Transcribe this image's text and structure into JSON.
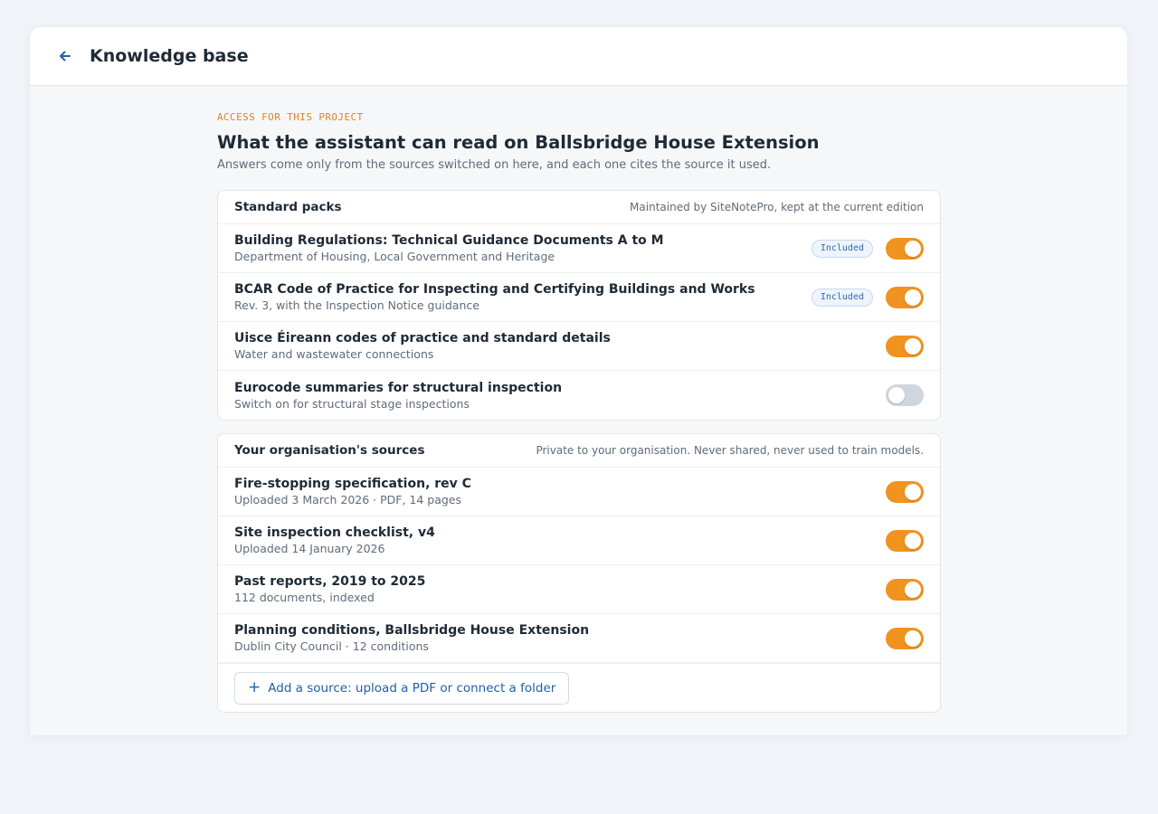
{
  "header": {
    "title": "Knowledge base",
    "back_icon": "arrow-left-icon"
  },
  "intro": {
    "eyebrow": "ACCESS FOR THIS PROJECT",
    "title": "What the assistant can read on Ballsbridge House Extension",
    "subtitle": "Answers come only from the sources switched on here, and each one cites the source it used."
  },
  "standard_packs": {
    "title": "Standard packs",
    "note": "Maintained by SiteNotePro, kept at the current edition",
    "items": [
      {
        "name": "Building Regulations: Technical Guidance Documents A to M",
        "desc": "Department of Housing, Local Government and Heritage",
        "badge": "Included",
        "enabled": true
      },
      {
        "name": "BCAR Code of Practice for Inspecting and Certifying Buildings and Works",
        "desc": "Rev. 3, with the Inspection Notice guidance",
        "badge": "Included",
        "enabled": true
      },
      {
        "name": "Uisce Éireann codes of practice and standard details",
        "desc": "Water and wastewater connections",
        "badge": "",
        "enabled": true
      },
      {
        "name": "Eurocode summaries for structural inspection",
        "desc": "Switch on for structural stage inspections",
        "badge": "",
        "enabled": false
      }
    ]
  },
  "org_sources": {
    "title": "Your organisation's sources",
    "note": "Private to your organisation. Never shared, never used to train models.",
    "items": [
      {
        "name": "Fire-stopping specification, rev C",
        "desc": "Uploaded 3 March 2026 · PDF, 14 pages",
        "enabled": true
      },
      {
        "name": "Site inspection checklist, v4",
        "desc": "Uploaded 14 January 2026",
        "enabled": true
      },
      {
        "name": "Past reports, 2019 to 2025",
        "desc": "112 documents, indexed",
        "enabled": true
      },
      {
        "name": "Planning conditions, Ballsbridge House Extension",
        "desc": "Dublin City Council · 12 conditions",
        "enabled": true
      }
    ],
    "add_label": "Add a source: upload a PDF or connect a folder",
    "add_icon": "plus-icon"
  },
  "colors": {
    "accent": "#f0931f",
    "link": "#1f5fa6",
    "eyebrow": "#e0861b",
    "toggle_off": "#cfd6de"
  }
}
